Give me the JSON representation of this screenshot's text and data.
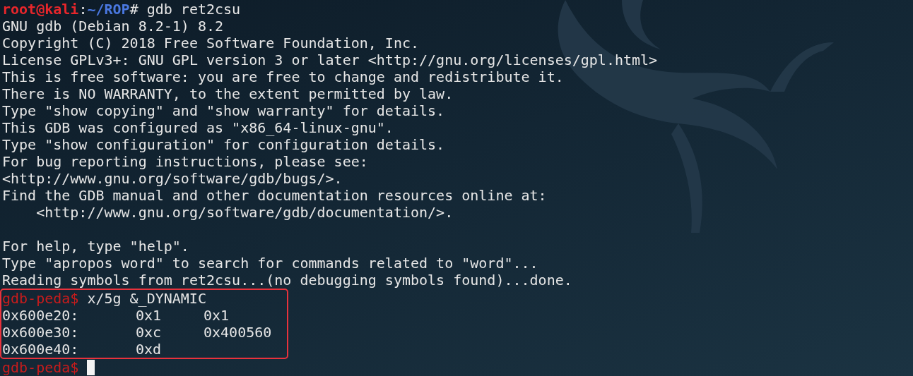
{
  "terminal": {
    "prompt": {
      "user_host": "root@kali",
      "separator": ":",
      "path": "~/ROP",
      "symbol": "#",
      "command": "gdb ret2csu"
    },
    "intro_lines": [
      "GNU gdb (Debian 8.2-1) 8.2",
      "Copyright (C) 2018 Free Software Foundation, Inc.",
      "License GPLv3+: GNU GPL version 3 or later <http://gnu.org/licenses/gpl.html>",
      "This is free software: you are free to change and redistribute it.",
      "There is NO WARRANTY, to the extent permitted by law.",
      "Type \"show copying\" and \"show warranty\" for details.",
      "This GDB was configured as \"x86_64-linux-gnu\".",
      "Type \"show configuration\" for configuration details.",
      "For bug reporting instructions, please see:",
      "<http://www.gnu.org/software/gdb/bugs/>.",
      "Find the GDB manual and other documentation resources online at:",
      "    <http://www.gnu.org/software/gdb/documentation/>."
    ],
    "help_lines": [
      "For help, type \"help\".",
      "Type \"apropos word\" to search for commands related to \"word\"...",
      "Reading symbols from ret2csu...(no debugging symbols found)...done."
    ],
    "highlight": {
      "prompt": "gdb-peda$",
      "command": "x/5g &_DYNAMIC",
      "memory_rows": [
        {
          "address": "0x600e20:",
          "values": [
            "0x1",
            "0x1"
          ]
        },
        {
          "address": "0x600e30:",
          "values": [
            "0xc",
            "0x400560"
          ]
        },
        {
          "address": "0x600e40:",
          "values": [
            "0xd"
          ]
        }
      ]
    },
    "final_prompt": "gdb-peda$",
    "cursor_visible": true
  }
}
